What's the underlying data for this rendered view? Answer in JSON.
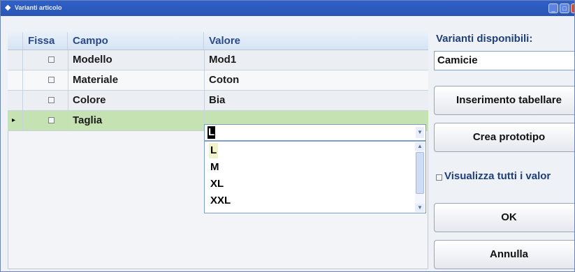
{
  "window": {
    "title": "Varianti articolo"
  },
  "grid": {
    "headers": {
      "fissa": "Fissa",
      "campo": "Campo",
      "valore": "Valore"
    },
    "rows": [
      {
        "campo": "Modello",
        "valore": "Mod1"
      },
      {
        "campo": "Materiale",
        "valore": "Coton"
      },
      {
        "campo": "Colore",
        "valore": "Bia"
      },
      {
        "campo": "Taglia",
        "valore": "L"
      }
    ],
    "dropdown_options": [
      "L",
      "M",
      "XL",
      "XXL"
    ]
  },
  "right_panel": {
    "varianti_label": "Varianti disponibili:",
    "varianti_value": "Camicie",
    "btn_inserimento": "Inserimento tabellare",
    "btn_prototipo": "Crea prototipo",
    "visualizza_label": "Visualizza tutti i valor",
    "btn_ok": "OK",
    "btn_annulla": "Annulla"
  },
  "colors": {
    "titlebar": "#2f5fc8",
    "selected_row": "#c4e2b2",
    "header_text": "#2a4a8a"
  }
}
